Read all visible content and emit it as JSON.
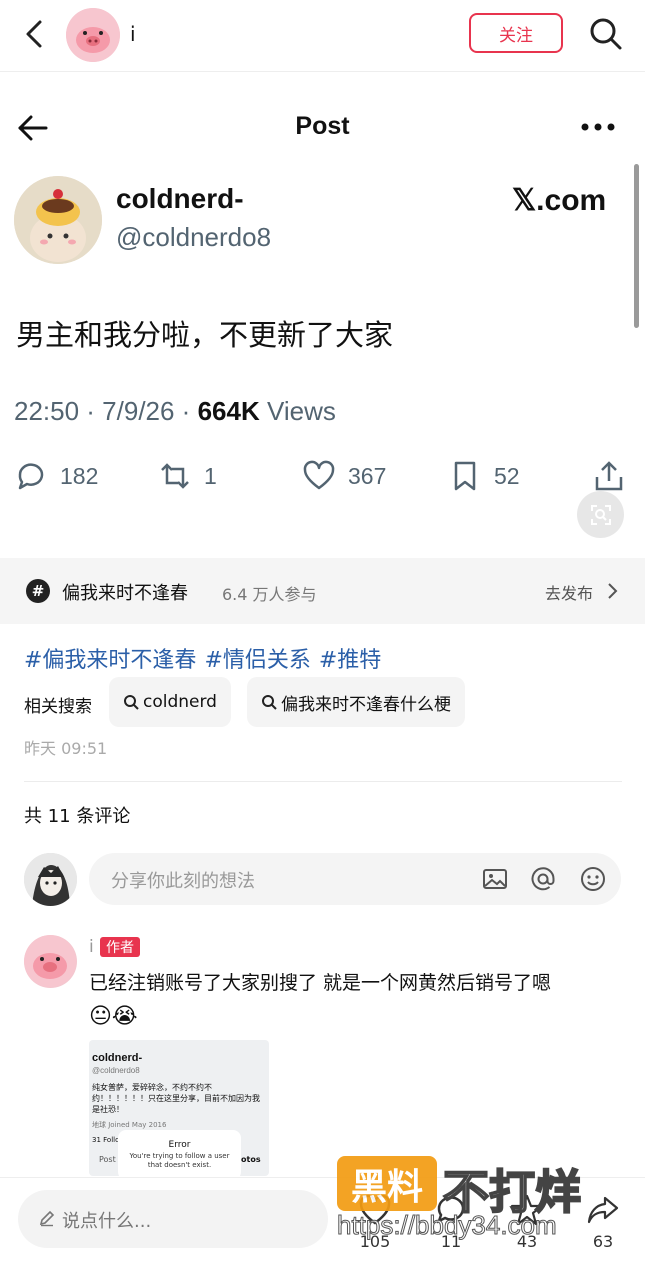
{
  "top_bar": {
    "username": "i",
    "follow_label": "关注"
  },
  "post_header": {
    "title": "Post"
  },
  "tweet": {
    "display_name": "coldnerd-",
    "handle": "@coldnerdo8",
    "brand": "𝕏.com",
    "text": "男主和我分啦，不更新了大家",
    "time": "22:50 · 7/9/26 ·",
    "views_count": "664K",
    "views_label": "Views",
    "replies": "182",
    "reposts": "1",
    "likes": "367",
    "bookmarks": "52"
  },
  "topic": {
    "name": "偏我来时不逢春",
    "participants": "6.4 万人参与",
    "action": "去发布"
  },
  "hashtags": [
    "#偏我来时不逢春",
    "#情侣关系",
    "#推特"
  ],
  "related": {
    "label": "相关搜索",
    "chips": [
      "coldnerd",
      "偏我来时不逢春什么梗"
    ]
  },
  "post_time": "昨天 09:51",
  "comments": {
    "count_label": "共 11 条评论",
    "input_placeholder": "分享你此刻的想法",
    "items": [
      {
        "name": "i",
        "badge": "作者",
        "text": "已经注销账号了大家别搜了 就是一个网黄然后销号了嗯",
        "emoji": "😐😭",
        "image": {
          "name": "coldnerd-",
          "handle": "@coldnerdo8",
          "bio": "纯女普萨，爱碎碎念，不约不约不约！！！！！！只在这里分享，目前不加因为我是社恐！",
          "meta": "地球  Joined May 2016",
          "following": "31 Follo",
          "tab_posts": "Post",
          "tab_photos": "otos",
          "error_title": "Error",
          "error_body": "You're trying to follow a user that doesn't exist."
        }
      }
    ]
  },
  "bottom_bar": {
    "say_placeholder": "说点什么...",
    "likes": "105",
    "comments": "11",
    "stars": "43",
    "shares": "63"
  },
  "watermark": {
    "box": "黑料",
    "text": "不打烊",
    "url": "https://bbdy34.com"
  }
}
